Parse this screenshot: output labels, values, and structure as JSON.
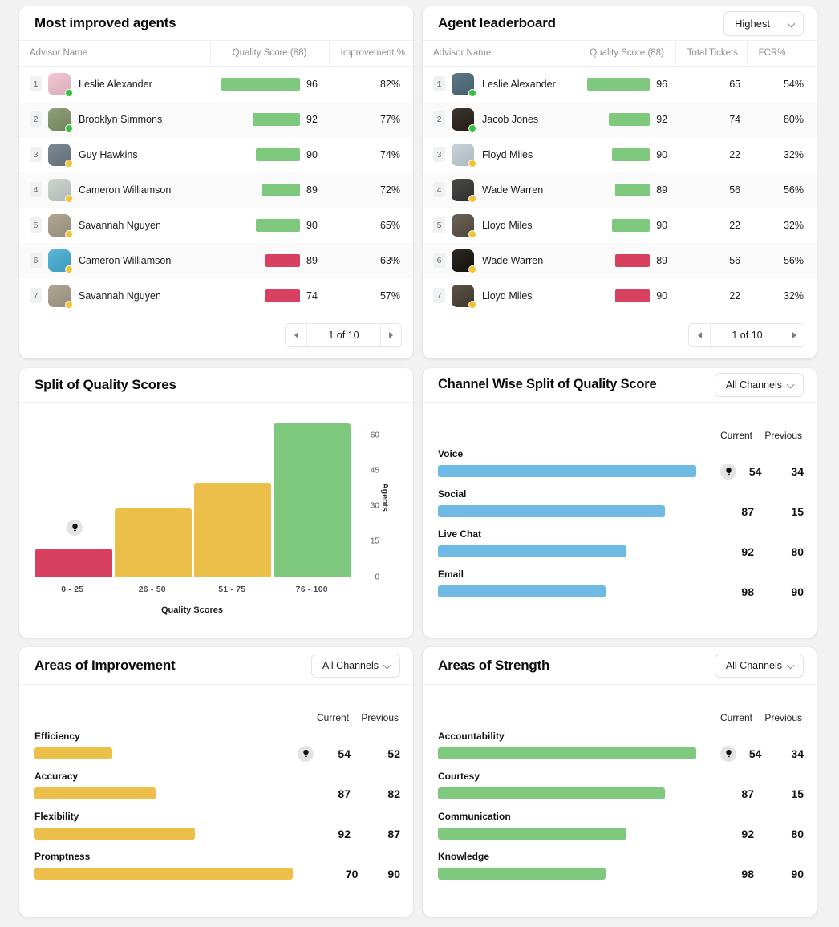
{
  "colors": {
    "green": "#7ec97e",
    "red": "#d7415f",
    "yellow": "#ecbf4a",
    "blue": "#6fb9e5",
    "online": "#34c23f",
    "away": "#f2c230"
  },
  "most_improved": {
    "title": "Most improved agents",
    "columns": [
      "Advisor Name",
      "Quality Score (88)",
      "Improvement %"
    ],
    "rows": [
      {
        "rank": "1",
        "name": "Leslie Alexander",
        "score": "96",
        "bar": 100,
        "color": "green",
        "status": "online",
        "improvement": "82%"
      },
      {
        "rank": "2",
        "name": "Brooklyn Simmons",
        "score": "92",
        "bar": 60,
        "color": "green",
        "status": "online",
        "improvement": "77%"
      },
      {
        "rank": "3",
        "name": "Guy Hawkins",
        "score": "90",
        "bar": 56,
        "color": "green",
        "status": "away",
        "improvement": "74%"
      },
      {
        "rank": "4",
        "name": "Cameron Williamson",
        "score": "89",
        "bar": 48,
        "color": "green",
        "status": "away",
        "improvement": "72%"
      },
      {
        "rank": "5",
        "name": "Savannah Nguyen",
        "score": "90",
        "bar": 56,
        "color": "green",
        "status": "away",
        "improvement": "65%"
      },
      {
        "rank": "6",
        "name": "Cameron Williamson",
        "score": "89",
        "bar": 44,
        "color": "red",
        "status": "away",
        "improvement": "63%"
      },
      {
        "rank": "7",
        "name": "Savannah Nguyen",
        "score": "74",
        "bar": 44,
        "color": "red",
        "status": "away",
        "improvement": "57%"
      }
    ],
    "pagination": {
      "label": "1 of 10",
      "prev_icon": "chevron-left-icon",
      "next_icon": "chevron-right-icon"
    }
  },
  "leaderboard": {
    "title": "Agent leaderboard",
    "sort_value": "Highest",
    "columns": [
      "Advisor Name",
      "Quality Score (88)",
      "Total Tickets",
      "FCR%"
    ],
    "rows": [
      {
        "rank": "1",
        "name": "Leslie Alexander",
        "score": "96",
        "bar": 100,
        "color": "green",
        "status": "online",
        "tickets": "65",
        "fcr": "54%"
      },
      {
        "rank": "2",
        "name": "Jacob Jones",
        "score": "92",
        "bar": 66,
        "color": "green",
        "status": "online",
        "tickets": "74",
        "fcr": "80%"
      },
      {
        "rank": "3",
        "name": "Floyd Miles",
        "score": "90",
        "bar": 60,
        "color": "green",
        "status": "away",
        "tickets": "22",
        "fcr": "32%"
      },
      {
        "rank": "4",
        "name": "Wade Warren",
        "score": "89",
        "bar": 55,
        "color": "green",
        "status": "away",
        "tickets": "56",
        "fcr": "56%"
      },
      {
        "rank": "5",
        "name": "Lloyd Miles",
        "score": "90",
        "bar": 60,
        "color": "green",
        "status": "away",
        "tickets": "22",
        "fcr": "32%"
      },
      {
        "rank": "6",
        "name": "Wade Warren",
        "score": "89",
        "bar": 55,
        "color": "red",
        "status": "away",
        "tickets": "56",
        "fcr": "56%"
      },
      {
        "rank": "7",
        "name": "Lloyd Miles",
        "score": "90",
        "bar": 55,
        "color": "red",
        "status": "away",
        "tickets": "22",
        "fcr": "32%"
      }
    ],
    "pagination": {
      "label": "1 of 10",
      "prev_icon": "chevron-left-icon",
      "next_icon": "chevron-right-icon"
    }
  },
  "split_card": {
    "title": "Split of Quality Scores"
  },
  "chart_data": {
    "type": "bar",
    "title": "Split of Quality Scores",
    "categories": [
      "0 - 25",
      "26 - 50",
      "51 - 75",
      "76 - 100"
    ],
    "values": [
      12,
      29,
      40,
      65
    ],
    "colors": [
      "#d7415f",
      "#ecbf4a",
      "#ecbf4a",
      "#7ec97e"
    ],
    "xlabel": "Quality Scores",
    "ylabel": "Agents",
    "yticks": [
      0,
      15,
      30,
      45,
      60
    ],
    "ylim": [
      0,
      68
    ],
    "grid": false,
    "legend": "none",
    "axis_position": "right"
  },
  "channel_split": {
    "title": "Channel Wise Split of Quality Score",
    "filter": "All Channels",
    "head_current": "Current",
    "head_previous": "Previous",
    "bar_color": "#6fb9e5",
    "rows": [
      {
        "label": "Voice",
        "bar": 100,
        "current": "54",
        "previous": "34",
        "bulb": true
      },
      {
        "label": "Social",
        "bar": 88,
        "current": "87",
        "previous": "15",
        "bulb": false
      },
      {
        "label": "Live Chat",
        "bar": 73,
        "current": "92",
        "previous": "80",
        "bulb": false
      },
      {
        "label": "Email",
        "bar": 65,
        "current": "98",
        "previous": "90",
        "bulb": false
      }
    ]
  },
  "improvement": {
    "title": "Areas of Improvement",
    "filter": "All Channels",
    "head_current": "Current",
    "head_previous": "Previous",
    "bar_color": "#ecbf4a",
    "rows": [
      {
        "label": "Efficiency",
        "bar": 30,
        "current": "54",
        "previous": "52",
        "bulb": true
      },
      {
        "label": "Accuracy",
        "bar": 47,
        "current": "87",
        "previous": "82",
        "bulb": false
      },
      {
        "label": "Flexibility",
        "bar": 62,
        "current": "92",
        "previous": "87",
        "bulb": false
      },
      {
        "label": "Promptness",
        "bar": 100,
        "current": "70",
        "previous": "90",
        "bulb": false
      }
    ]
  },
  "strength": {
    "title": "Areas of Strength",
    "filter": "All Channels",
    "head_current": "Current",
    "head_previous": "Previous",
    "bar_color": "#7ec97e",
    "rows": [
      {
        "label": "Accountability",
        "bar": 100,
        "current": "54",
        "previous": "34",
        "bulb": true
      },
      {
        "label": "Courtesy",
        "bar": 88,
        "current": "87",
        "previous": "15",
        "bulb": false
      },
      {
        "label": "Communication",
        "bar": 73,
        "current": "92",
        "previous": "80",
        "bulb": false
      },
      {
        "label": "Knowledge",
        "bar": 65,
        "current": "98",
        "previous": "90",
        "bulb": false
      }
    ]
  }
}
